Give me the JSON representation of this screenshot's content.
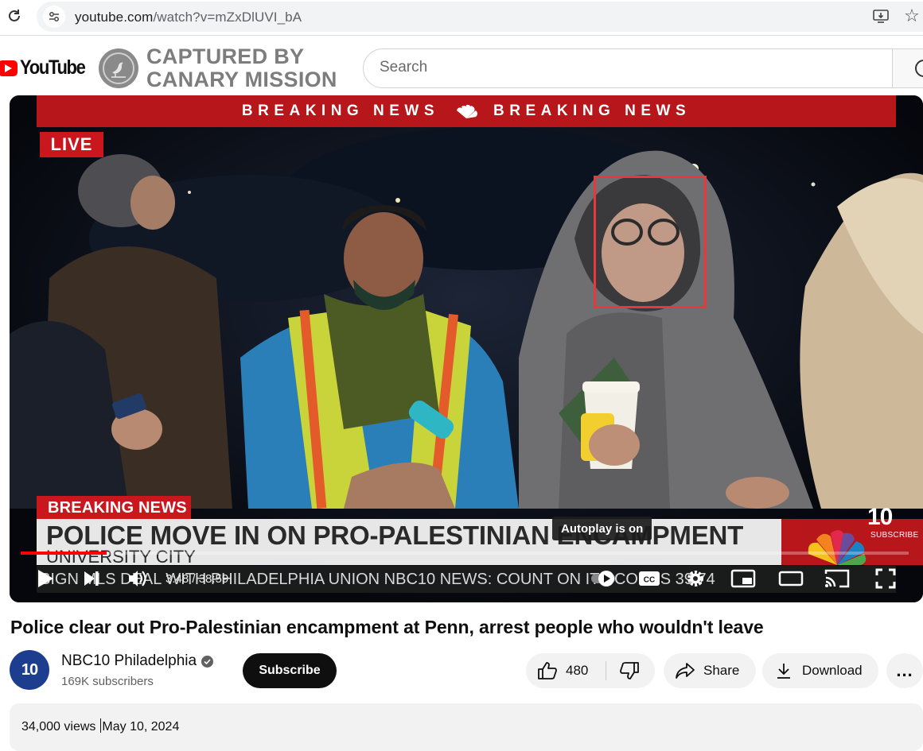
{
  "browser": {
    "url_domain": "youtube.com",
    "url_path": "/watch?v=mZxDlUVI_bA"
  },
  "masthead": {
    "logo_text": "YouTube",
    "watermark_line1": "CAPTURED BY",
    "watermark_line2": "CANARY MISSION",
    "search_placeholder": "Search"
  },
  "player": {
    "banner_left": "BREAKING NEWS",
    "banner_right": "BREAKING NEWS",
    "live_label": "LIVE",
    "lower_third_tag": "BREAKING NEWS",
    "headline": "POLICE MOVE IN ON PRO-PALESTINIAN ENCAMPMENT",
    "subline": "UNIVERSITY CITY",
    "channel_bug": "10",
    "channel_bug_sub": "SUBSCRIBE",
    "ticker": "SIGN MLS DEAL WITH PHILADELPHIA UNION    NBC10 NEWS: COUNT ON IT    SCORES 39  74",
    "autoplay_tooltip": "Autoplay is on",
    "time_current": "3:48",
    "time_total": "38:59",
    "time_display": "3:48 / 38:59",
    "progress_fraction": 0.097,
    "icons": [
      "play-icon",
      "next-icon",
      "volume-icon",
      "autoplay-toggle-icon",
      "captions-icon",
      "settings-icon",
      "miniplayer-icon",
      "theater-icon",
      "cast-icon",
      "fullscreen-icon"
    ]
  },
  "video": {
    "title": "Police clear out Pro-Palestinian encampment at Penn, arrest people who wouldn't leave",
    "channel_name": "NBC10 Philadelphia",
    "channel_avatar_text": "10",
    "subscribers": "169K subscribers",
    "subscribe_label": "Subscribe",
    "like_count": "480",
    "share_label": "Share",
    "download_label": "Download",
    "more_label": "..."
  },
  "description": {
    "views": "34,000 views",
    "date": "May 10, 2024"
  }
}
